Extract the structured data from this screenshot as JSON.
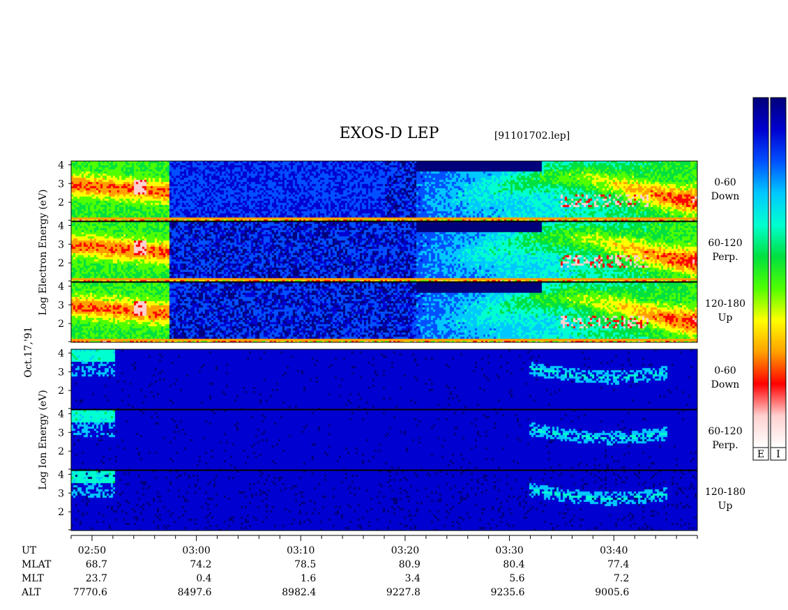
{
  "chart_data": {
    "type": "heatmap",
    "title": "EXOS-D LEP",
    "file": "[91101702.lep]",
    "date_label": "Oct.17,'91",
    "x_axis": {
      "unit": "UT",
      "start": "02:48",
      "end": "03:48",
      "ticks": [
        "02:50",
        "03:00",
        "03:10",
        "03:20",
        "03:30",
        "03:40"
      ]
    },
    "species": [
      {
        "id": "electron",
        "ylabel": [
          "Log",
          "Electron",
          "Energy",
          "(eV)"
        ],
        "ylim": [
          1,
          4.2
        ],
        "yticks": [
          "4",
          "3",
          "2"
        ],
        "panels": [
          {
            "range": "0-60",
            "dir": "Down"
          },
          {
            "range": "60-120",
            "dir": "Perp."
          },
          {
            "range": "120-180",
            "dir": "Up"
          }
        ]
      },
      {
        "id": "ion",
        "ylabel": [
          "Log",
          "Ion",
          "Energy",
          "(eV)"
        ],
        "ylim": [
          1,
          4.2
        ],
        "yticks": [
          "4",
          "3",
          "2"
        ],
        "panels": [
          {
            "range": "0-60",
            "dir": "Down"
          },
          {
            "range": "60-120",
            "dir": "Perp."
          },
          {
            "range": "120-180",
            "dir": "Up"
          }
        ]
      }
    ],
    "colorbars": [
      "E",
      "I"
    ],
    "colorscale": [
      "#00007a",
      "#0000d0",
      "#0050ff",
      "#00c8ff",
      "#00ffd0",
      "#00e040",
      "#50ff00",
      "#ffff00",
      "#ffa000",
      "#ff0000",
      "#ffd0d0",
      "#ffffff"
    ],
    "ephemeris": {
      "rows": [
        {
          "label": "UT",
          "values": [
            "02:50",
            "03:00",
            "03:10",
            "03:20",
            "03:30",
            "03:40"
          ]
        },
        {
          "label": "MLAT",
          "values": [
            "68.7",
            "74.2",
            "78.5",
            "80.9",
            "80.4",
            "77.4"
          ]
        },
        {
          "label": "MLT",
          "values": [
            "23.7",
            "0.4",
            "1.6",
            "3.4",
            "5.6",
            "7.2"
          ]
        },
        {
          "label": "ALT",
          "values": [
            "7770.6",
            "8497.6",
            "8982.4",
            "9227.8",
            "9235.6",
            "9005.6"
          ]
        }
      ]
    }
  }
}
